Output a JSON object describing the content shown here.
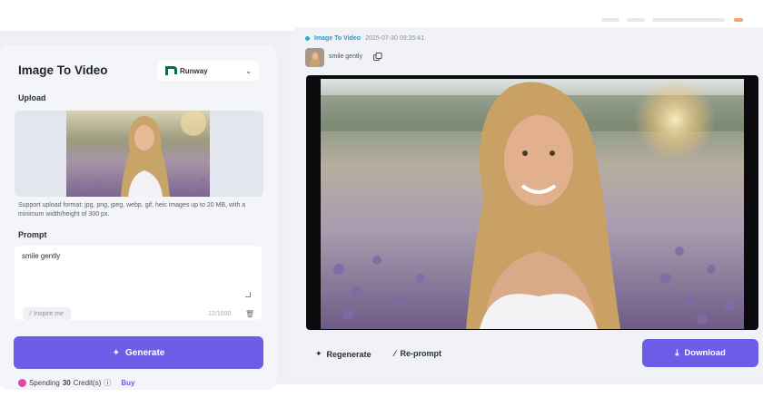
{
  "panel": {
    "title": "Image To Video",
    "model": "Runway",
    "upload_label": "Upload",
    "upload_help": "Support upload format: jpg, png, jpeg, webp, gif, heic images up to 20 MB, with a minimum width/height of 300 px.",
    "prompt_label": "Prompt",
    "prompt_value": "smile gently",
    "inspire_label": "Inspire me",
    "char_count": "12/1000",
    "generate_label": "Generate",
    "spending_prefix": "Spending",
    "spending_amount": "30",
    "spending_suffix": "Credit(s)",
    "buy_label": "Buy"
  },
  "result": {
    "tag": "Image To Video",
    "timestamp": "2025-07-30 09:35:41",
    "prompt_echo": "smile gently",
    "regenerate_label": "Regenerate",
    "reprompt_label": "Re-prompt",
    "download_label": "Download"
  },
  "colors": {
    "accent": "#6c5ce7",
    "tag": "#1a9fd0",
    "coin": "#e048a6"
  },
  "icons": [
    "runway-logo-icon",
    "chevron-down-icon",
    "sparkle-icon",
    "wand-icon",
    "trash-icon",
    "copy-icon",
    "download-icon",
    "help-icon",
    "coin-icon"
  ]
}
